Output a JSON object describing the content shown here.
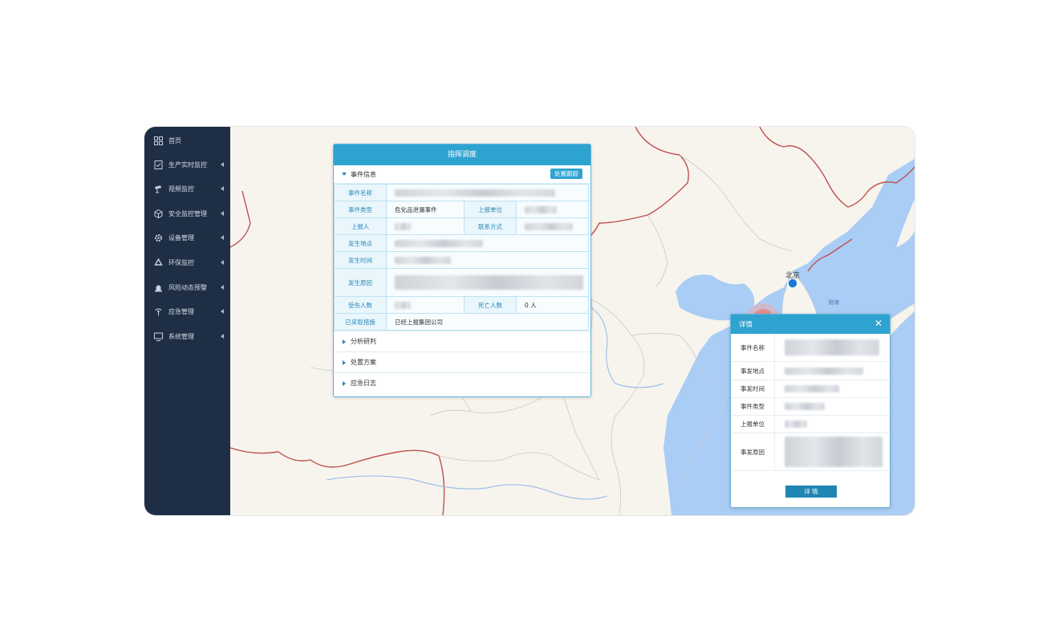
{
  "sidebar": {
    "items": [
      {
        "label": "首页",
        "icon": "grid-icon"
      },
      {
        "label": "生产实时监控",
        "icon": "checklist-icon"
      },
      {
        "label": "视频监控",
        "icon": "camera-icon"
      },
      {
        "label": "安全监控管理",
        "icon": "cube-icon"
      },
      {
        "label": "设备管理",
        "icon": "gear-icon"
      },
      {
        "label": "环保监控",
        "icon": "recycle-icon"
      },
      {
        "label": "风险动态预警",
        "icon": "alarm-icon"
      },
      {
        "label": "应急管理",
        "icon": "antenna-icon"
      },
      {
        "label": "系统管理",
        "icon": "monitor-icon"
      }
    ]
  },
  "map": {
    "city_label": "北京",
    "sea_label": "渤海",
    "colors": {
      "land": "#f7f4ee",
      "water": "#a9cdf5",
      "border": "#c0504d",
      "province": "#c9c9c9",
      "river": "#8fb6e6"
    }
  },
  "dispatch": {
    "title": "指挥调度",
    "section_event": "事件信息",
    "track_button": "处置跟踪",
    "labels": {
      "event_name": "事件名称",
      "event_type": "事件类型",
      "report_unit": "上报单位",
      "reporter": "上报人",
      "contact": "联系方式",
      "location": "发生地点",
      "time": "发生时间",
      "cause": "发生原因",
      "injured": "受伤人数",
      "deaths": "死亡人数",
      "measures": "已采取措施"
    },
    "values": {
      "event_type": "危化品泄漏事件",
      "deaths": "0 人",
      "measures": "已经上报集团公司"
    },
    "sections": [
      "分析研判",
      "处置方案",
      "应急日志"
    ]
  },
  "detail": {
    "title": "详情",
    "labels": [
      "事件名称",
      "事发地点",
      "事发时间",
      "事件类型",
      "上报单位",
      "事发原因"
    ],
    "button": "详 情"
  }
}
